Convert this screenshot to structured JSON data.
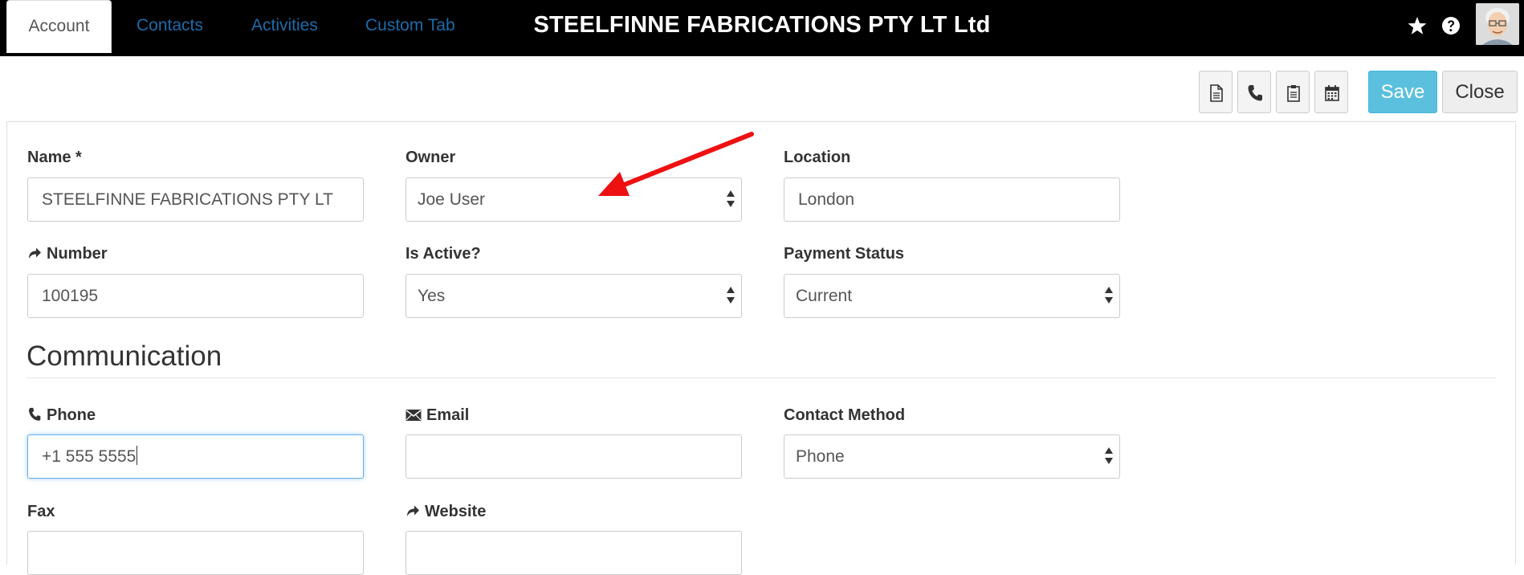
{
  "header": {
    "title": "STEELFINNE FABRICATIONS PTY LT Ltd"
  },
  "tabs": [
    {
      "label": "Account"
    },
    {
      "label": "Contacts"
    },
    {
      "label": "Activities"
    },
    {
      "label": "Custom Tab"
    }
  ],
  "toolbar": {
    "save_label": "Save",
    "close_label": "Close",
    "icons": [
      "document-icon",
      "phone-icon",
      "clipboard-icon",
      "calendar-icon"
    ]
  },
  "form": {
    "name": {
      "label": "Name *",
      "value": "STEELFINNE FABRICATIONS PTY LT"
    },
    "owner": {
      "label": "Owner",
      "value": "Joe User"
    },
    "location": {
      "label": "Location",
      "value": "London"
    },
    "number": {
      "label": "Number",
      "value": "100195"
    },
    "is_active": {
      "label": "Is Active?",
      "value": "Yes"
    },
    "payment_status": {
      "label": "Payment Status",
      "value": "Current"
    }
  },
  "communication": {
    "heading": "Communication",
    "phone": {
      "label": "Phone",
      "value": "+1 555 5555"
    },
    "email": {
      "label": "Email",
      "value": ""
    },
    "contact_method": {
      "label": "Contact Method",
      "value": "Phone"
    },
    "fax": {
      "label": "Fax",
      "value": ""
    },
    "website": {
      "label": "Website",
      "value": ""
    }
  },
  "colors": {
    "topbar": "#000000",
    "link": "#1c6bab",
    "save": "#5bc0de",
    "annotation_arrow": "#ee1111"
  }
}
